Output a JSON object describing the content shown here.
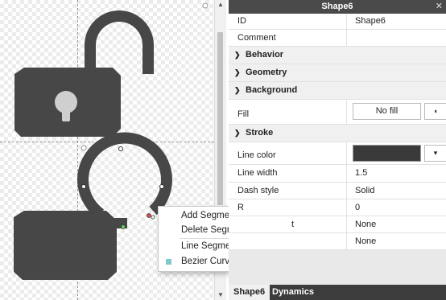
{
  "window": {
    "title": "Shape6"
  },
  "properties": {
    "id_label": "ID",
    "id_value": "Shape6",
    "comment_label": "Comment",
    "comment_value": "",
    "sections": {
      "behavior": "Behavior",
      "geometry": "Geometry",
      "background": "Background",
      "stroke": "Stroke"
    },
    "fill_label": "Fill",
    "fill_value": "No fill",
    "line_color_label": "Line color",
    "line_width_label": "Line width",
    "line_width_value": "1.5",
    "dash_style_label": "Dash style",
    "dash_style_value": "Solid",
    "radius_label": "R",
    "radius_value": "0",
    "start_cap_label": "t",
    "start_cap_value": "None",
    "end_cap_label": "",
    "end_cap_value": "None"
  },
  "context_menu": {
    "items": [
      "Add Segment",
      "Delete Segment",
      "Line Segment",
      "Bezier Curve"
    ],
    "checked": "Bezier Curve"
  },
  "tabs": [
    "Shape6",
    "Dynamics"
  ],
  "colors": {
    "shape": "#474747",
    "line_color": "#3a3a3a",
    "accent": "#7ec9cf",
    "title_bar": "#4a4a4a"
  },
  "icons": {
    "close": "close-icon",
    "chevron_right": "chevron-right-icon",
    "chevron_down": "chevron-down-icon"
  }
}
